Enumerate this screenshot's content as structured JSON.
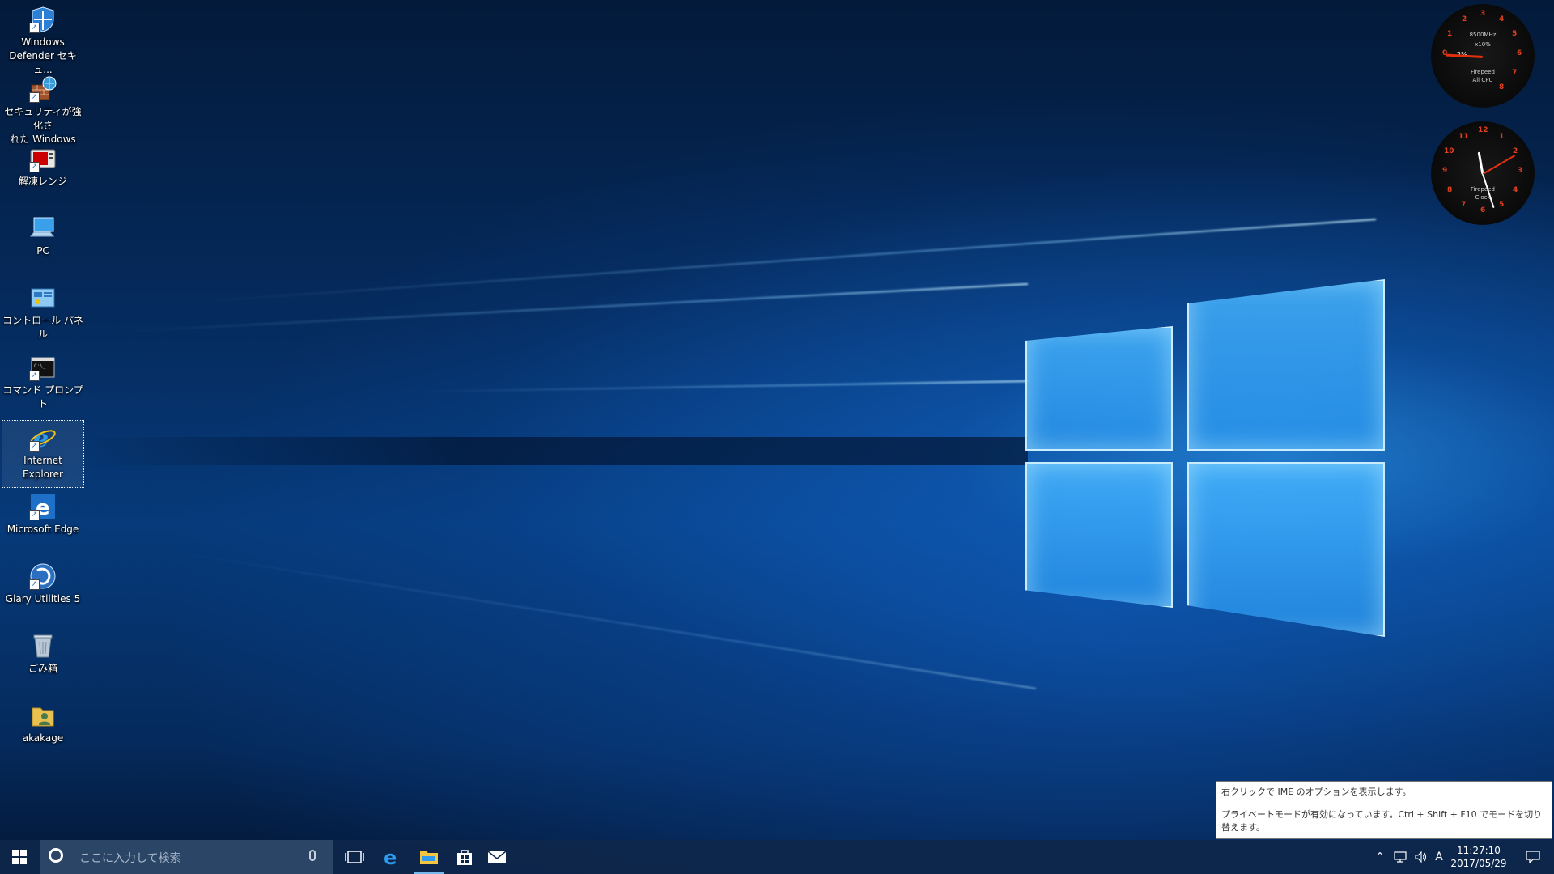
{
  "desktop_icons": [
    {
      "label_line1": "Windows",
      "label_line2": "Defender セキュ...",
      "icon": "windows-defender-shield-icon"
    },
    {
      "label_line1": "セキュリティが強化さ",
      "label_line2": "れた Windows フ...",
      "icon": "firewall-icon"
    },
    {
      "label_line1": "解凍レンジ",
      "label_line2": "",
      "icon": "microwave-icon"
    },
    {
      "label_line1": "PC",
      "label_line2": "",
      "icon": "computer-icon"
    },
    {
      "label_line1": "コントロール パネル",
      "label_line2": "",
      "icon": "control-panel-icon"
    },
    {
      "label_line1": "コマンド プロンプト",
      "label_line2": "",
      "icon": "command-prompt-icon"
    },
    {
      "label_line1": "Internet Explorer",
      "label_line2": "",
      "icon": "internet-explorer-icon"
    },
    {
      "label_line1": "Microsoft Edge",
      "label_line2": "",
      "icon": "edge-icon"
    },
    {
      "label_line1": "Glary Utilities 5",
      "label_line2": "",
      "icon": "glary-utilities-icon"
    },
    {
      "label_line1": "ごみ箱",
      "label_line2": "",
      "icon": "recycle-bin-icon"
    },
    {
      "label_line1": "akakage",
      "label_line2": "",
      "icon": "user-folder-icon"
    }
  ],
  "gadgets": {
    "cpu": {
      "brand": "Firepeed",
      "label": "All CPU",
      "freq": "8500MHz",
      "multiplier": "x10%",
      "value": "2%"
    },
    "clock": {
      "brand": "Firepeed",
      "label": "Clock"
    }
  },
  "tooltip": {
    "line1": "右クリックで IME のオプションを表示します。",
    "line2": "プライベートモードが有効になっています。Ctrl + Shift + F10 でモードを切り替えます。"
  },
  "taskbar": {
    "search_placeholder": "ここに入力して検索",
    "time": "11:27:10",
    "date": "2017/05/29",
    "ime_mode": "A"
  },
  "colors": {
    "taskbar": "#0e264a",
    "accent": "#76b9ed",
    "gauge_numbers": "#e04020"
  }
}
